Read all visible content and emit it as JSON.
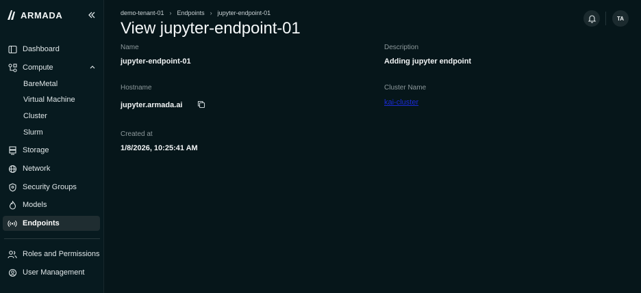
{
  "brand": {
    "name": "ARMADA"
  },
  "sidebar": {
    "items": [
      {
        "label": "Dashboard",
        "icon": "dashboard-icon"
      },
      {
        "label": "Compute",
        "icon": "compute-icon"
      },
      {
        "label": "Storage",
        "icon": "storage-icon"
      },
      {
        "label": "Network",
        "icon": "network-icon"
      },
      {
        "label": "Security Groups",
        "icon": "shield-icon"
      },
      {
        "label": "Models",
        "icon": "flame-icon"
      },
      {
        "label": "Endpoints",
        "icon": "broadcast-icon",
        "active": true
      },
      {
        "label": "Roles and Permissions",
        "icon": "users-icon"
      },
      {
        "label": "User Management",
        "icon": "user-settings-icon"
      }
    ],
    "compute_sub": [
      "BareMetal",
      "Virtual Machine",
      "Cluster",
      "Slurm"
    ]
  },
  "breadcrumb": [
    "demo-tenant-01",
    "Endpoints",
    "jupyter-endpoint-01"
  ],
  "page": {
    "title": "View jupyter-endpoint-01"
  },
  "details": {
    "name_label": "Name",
    "name_value": "jupyter-endpoint-01",
    "description_label": "Description",
    "description_value": "Adding jupyter endpoint",
    "hostname_label": "Hostname",
    "hostname_value": "jupyter.armada.ai",
    "cluster_label": "Cluster Name",
    "cluster_value": "kai-cluster",
    "created_label": "Created at",
    "created_value": "1/8/2026, 10:25:41 AM"
  },
  "header": {
    "avatar_initials": "TA"
  },
  "colors": {
    "background": "#06161a",
    "sidebar": "#071a1f",
    "active": "#1f2d31",
    "link": "#1a2bd6"
  }
}
